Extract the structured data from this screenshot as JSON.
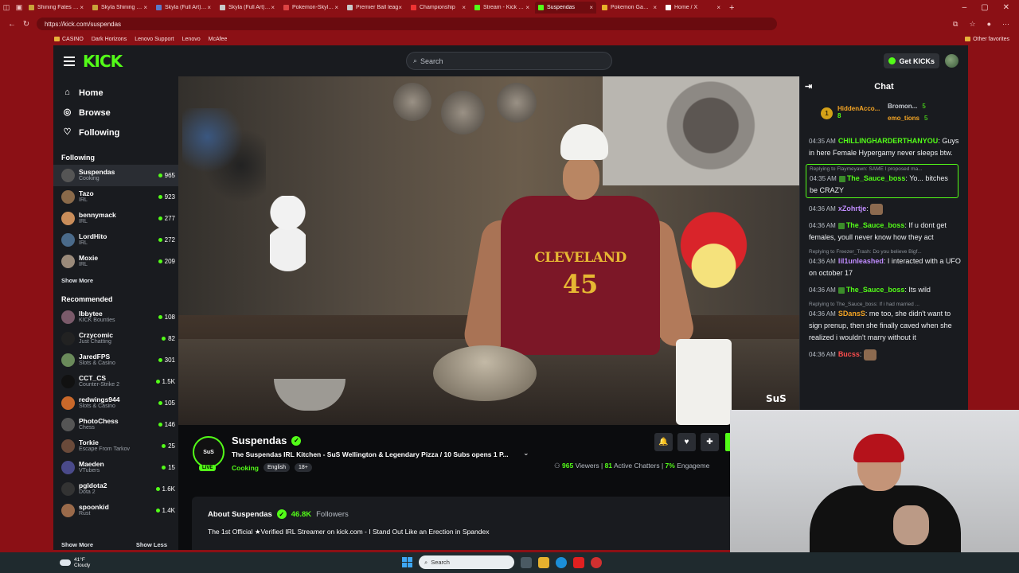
{
  "browser": {
    "tabs": [
      {
        "label": "Shining Fates Cas",
        "color": "#c9a43a"
      },
      {
        "label": "Skyla Shining Fate",
        "color": "#c9a43a"
      },
      {
        "label": "Skyla (Full Art) - S",
        "color": "#5a7ac9"
      },
      {
        "label": "Skyla (Full Art) - S",
        "color": "#c9c9c9"
      },
      {
        "label": "Pokemon-Skyla (F",
        "color": "#d44"
      },
      {
        "label": "Premier Ball leag",
        "color": "#c9c9c9"
      },
      {
        "label": "Championship",
        "color": "#e33"
      },
      {
        "label": "Stream - Kick Dash",
        "color": "#53fc18"
      },
      {
        "label": "Suspendas",
        "color": "#53fc18"
      },
      {
        "label": "Pokemon Games (",
        "color": "#e8b22a"
      },
      {
        "label": "Home / X",
        "color": "#fff"
      }
    ],
    "url": "https://kick.com/suspendas",
    "bookmarks": [
      "CASINO",
      "Dark Horizons",
      "Lenovo Support",
      "Lenovo",
      "McAfee"
    ],
    "other_favorites": "Other favorites"
  },
  "site": {
    "logo": "KICK",
    "search_placeholder": "Search",
    "get_kicks": "Get KICKs"
  },
  "sidebar": {
    "nav": [
      {
        "label": "Home",
        "icon": "home-icon"
      },
      {
        "label": "Browse",
        "icon": "browse-icon"
      },
      {
        "label": "Following",
        "icon": "heart-icon"
      }
    ],
    "following_title": "Following",
    "following": [
      {
        "name": "Suspendas",
        "category": "Cooking",
        "viewers": "965",
        "color": "#555"
      },
      {
        "name": "Tazo",
        "category": "IRL",
        "viewers": "923",
        "color": "#8a6a4a"
      },
      {
        "name": "bennymack",
        "category": "IRL",
        "viewers": "277",
        "color": "#c98d5a"
      },
      {
        "name": "LordHito",
        "category": "IRL",
        "viewers": "272",
        "color": "#4a6a8a"
      },
      {
        "name": "Moxie",
        "category": "IRL",
        "viewers": "209",
        "color": "#9a8a7a"
      }
    ],
    "show_more": "Show More",
    "recommended_title": "Recommended",
    "recommended": [
      {
        "name": "lbbytee",
        "category": "KICK Bounties",
        "viewers": "108",
        "color": "#7a5a6a"
      },
      {
        "name": "Crzycomic",
        "category": "Just Chatting",
        "viewers": "82",
        "color": "#222"
      },
      {
        "name": "JaredFPS",
        "category": "Slots & Casino",
        "viewers": "301",
        "color": "#6a8a5a"
      },
      {
        "name": "CCT_CS",
        "category": "Counter-Strike 2",
        "viewers": "1.5K",
        "color": "#111"
      },
      {
        "name": "redwings944",
        "category": "Slots & Casino",
        "viewers": "105",
        "color": "#c9682a"
      },
      {
        "name": "PhotoChess",
        "category": "Chess",
        "viewers": "146",
        "color": "#555"
      },
      {
        "name": "Torkie",
        "category": "Escape From Tarkov",
        "viewers": "25",
        "color": "#6a4a3a"
      },
      {
        "name": "Maeden",
        "category": "VTubers",
        "viewers": "15",
        "color": "#4a4a8a"
      },
      {
        "name": "pgldota2",
        "category": "Dota 2",
        "viewers": "1.6K",
        "color": "#333"
      },
      {
        "name": "spoonkid",
        "category": "Rust",
        "viewers": "1.4K",
        "color": "#9a6a4a"
      }
    ],
    "show_more_bottom": "Show More",
    "show_less": "Show Less"
  },
  "video": {
    "jersey_text": "CLEVELAND",
    "jersey_number": "45",
    "watermark": "SuS"
  },
  "chat": {
    "title": "Chat",
    "top_gifter": {
      "rank": "1",
      "name": "HiddenAcco...",
      "count": "8"
    },
    "gifters": [
      {
        "name": "Bromon...",
        "count": "5"
      },
      {
        "name": "emo_tions",
        "count": "5"
      }
    ],
    "messages": [
      {
        "time": "04:35 AM",
        "user": "CHILLINGHARDERTHANYOU",
        "color": "#53fc18",
        "text": ": Guys in here Female Hypergamy never sleeps btw.",
        "reply": ""
      },
      {
        "time": "04:35 AM",
        "user": "The_Sauce_boss",
        "color": "#53fc18",
        "text": ": Yo... bitches be CRAZY",
        "reply": "Replying to Flaymeyawn: SAME I proposed ma...",
        "highlight": true
      },
      {
        "time": "04:36 AM",
        "user": "xZohrtje",
        "color": "#c08cff",
        "text": ":",
        "reply": ""
      },
      {
        "time": "04:36 AM",
        "user": "The_Sauce_boss",
        "color": "#53fc18",
        "text": ": If u dont get females, youll never know how they act",
        "reply": ""
      },
      {
        "time": "04:36 AM",
        "user": "lil1unleashed",
        "color": "#c08cff",
        "text": ": I interacted with a UFO on october 17",
        "reply": "Replying to Freezer_Trash: Do you believe Bigf..."
      },
      {
        "time": "04:36 AM",
        "user": "The_Sauce_boss",
        "color": "#53fc18",
        "text": ": Its wild",
        "reply": ""
      },
      {
        "time": "04:36 AM",
        "user": "SDansS",
        "color": "#f5a524",
        "text": ": me too, she didn't want to sign prenup, then she finally caved when she realized i wouldn't marry without it",
        "reply": "Replying to The_Sauce_boss: If i had married ..."
      },
      {
        "time": "04:36 AM",
        "user": "Bucss",
        "color": "#ff4d4d",
        "text": ":",
        "reply": ""
      }
    ]
  },
  "channel": {
    "name": "Suspendas",
    "live": "LIVE",
    "title": "The Suspendas IRL Kitchen - SuS Wellington & Legendary Pizza / 10 Subs opens 1 P...",
    "category": "Cooking",
    "tags": [
      "English",
      "18+"
    ],
    "viewers": "965",
    "viewers_label": "Viewers",
    "chatters": "81",
    "chatters_label": "Active Chatters",
    "engagement": "7%",
    "engagement_label": "Engageme",
    "about_title": "About Suspendas",
    "followers": "46.8K",
    "followers_label": "Followers",
    "bio": "The 1st Official ★Verified IRL Streamer on kick.com - I Stand Out Like an Erection in Spandex"
  },
  "taskbar": {
    "temp": "41°F",
    "condition": "Cloudy",
    "search": "Search"
  }
}
